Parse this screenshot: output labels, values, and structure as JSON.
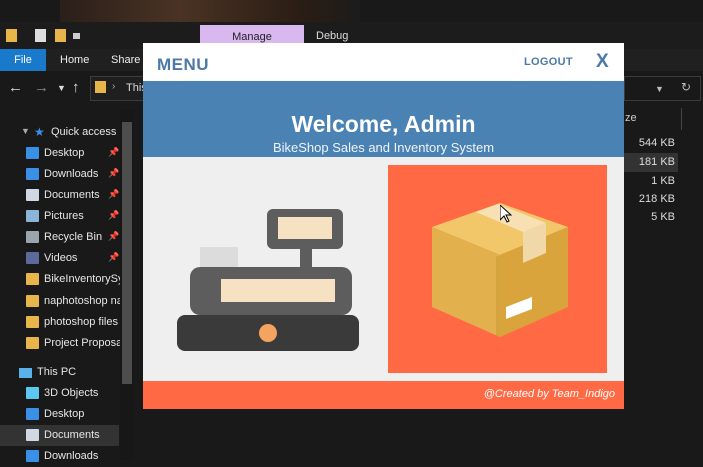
{
  "explorer": {
    "ribbon_tabs": [
      "File",
      "Home",
      "Share"
    ],
    "context_tab": "Manage",
    "debug_tab": "Debug",
    "address_path": "This",
    "column_header": "ze",
    "file_sizes": [
      "544 KB",
      "181 KB",
      "1 KB",
      "218 KB",
      "5 KB"
    ],
    "quick_access_label": "Quick access",
    "nav_items": [
      {
        "label": "Desktop",
        "icon": "desktop-icon",
        "pinned": true
      },
      {
        "label": "Downloads",
        "icon": "downloads-icon",
        "pinned": true
      },
      {
        "label": "Documents",
        "icon": "documents-icon",
        "pinned": true
      },
      {
        "label": "Pictures",
        "icon": "pictures-icon",
        "pinned": true
      },
      {
        "label": "Recycle Bin",
        "icon": "recycle-bin-icon",
        "pinned": true
      },
      {
        "label": "Videos",
        "icon": "videos-icon",
        "pinned": true
      },
      {
        "label": "BikeInventorySys",
        "icon": "folder-icon",
        "pinned": false
      },
      {
        "label": "naphotoshop na",
        "icon": "folder-icon",
        "pinned": false
      },
      {
        "label": "photoshop files",
        "icon": "folder-icon",
        "pinned": false
      },
      {
        "label": "Project Proposal",
        "icon": "folder-icon",
        "pinned": false
      }
    ],
    "this_pc_label": "This PC",
    "pc_items": [
      {
        "label": "3D Objects",
        "icon": "3d-objects-icon"
      },
      {
        "label": "Desktop",
        "icon": "desktop-icon"
      },
      {
        "label": "Documents",
        "icon": "documents-icon"
      },
      {
        "label": "Downloads",
        "icon": "downloads-icon"
      }
    ],
    "colors": {
      "background": "#191919",
      "accent": "#1979ca",
      "manage_tab": "#d9b8f0"
    }
  },
  "app": {
    "menu_title": "MENU",
    "logout_label": "LOGOUT",
    "close_label": "X",
    "welcome": "Welcome, Admin",
    "subtitle": "BikeShop Sales and Inventory System",
    "cards": [
      {
        "name": "pos",
        "icon": "cash-register-icon"
      },
      {
        "name": "inventory",
        "icon": "box-icon"
      }
    ],
    "credit": "@Created by Team_Indigo",
    "colors": {
      "primary": "#4a82b4",
      "accent": "#ff6a45",
      "title_text": "#4b7aa6"
    }
  }
}
